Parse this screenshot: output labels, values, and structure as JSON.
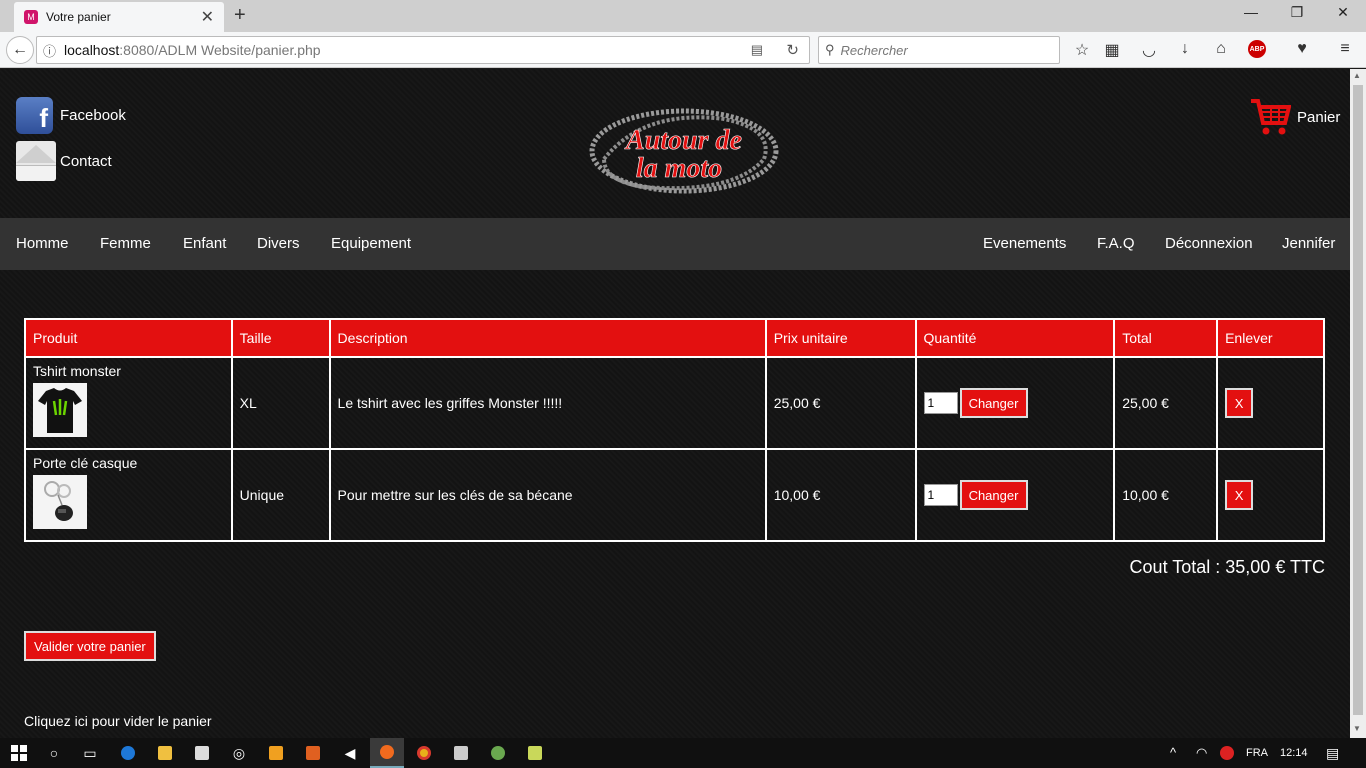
{
  "browser": {
    "tab_title": "Votre panier",
    "url_host": "localhost",
    "url_path": ":8080/ADLM Website/panier.php",
    "search_placeholder": "Rechercher",
    "abp_label": "ABP"
  },
  "header": {
    "facebook_label": "Facebook",
    "contact_label": "Contact",
    "logo_text_line1": "Autour de",
    "logo_text_line2": "la moto",
    "cart_label": "Panier"
  },
  "menu": {
    "left": [
      "Homme",
      "Femme",
      "Enfant",
      "Divers",
      "Equipement"
    ],
    "right": [
      "Evenements",
      "F.A.Q",
      "Déconnexion",
      "Jennifer"
    ]
  },
  "cart": {
    "columns": [
      "Produit",
      "Taille",
      "Description",
      "Prix unitaire",
      "Quantité",
      "Total",
      "Enlever"
    ],
    "rows": [
      {
        "product": "Tshirt monster",
        "size": "XL",
        "description": "Le tshirt avec les griffes Monster !!!!!",
        "unit_price": "25,00 €",
        "quantity": "1",
        "total": "25,00 €"
      },
      {
        "product": "Porte clé casque",
        "size": "Unique",
        "description": "Pour mettre sur les clés de sa bécane",
        "unit_price": "10,00 €",
        "quantity": "1",
        "total": "10,00 €"
      }
    ],
    "change_label": "Changer",
    "remove_label": "X",
    "total_label": "Cout Total : 35,00 € TTC",
    "validate_label": "Valider votre panier",
    "empty_label": "Cliquez ici pour vider le panier"
  },
  "taskbar": {
    "language": "FRA",
    "time": "12:14"
  },
  "colors": {
    "accent": "#e31010",
    "menu_bg": "#333333",
    "page_bg": "#141414"
  }
}
